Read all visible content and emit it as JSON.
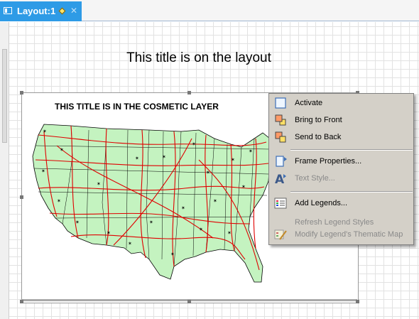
{
  "tab": {
    "label": "Layout:1"
  },
  "layout_title": "This title is on the layout",
  "cosmetic_title": "THIS TITLE IS IN THE COSMETIC LAYER",
  "map": {
    "land_color": "#c4f3c0",
    "road_color": "#e00000",
    "border_color": "#000000"
  },
  "context_menu": {
    "items": [
      {
        "label": "Activate",
        "icon": "activate-icon",
        "enabled": true
      },
      {
        "label": "Bring to Front",
        "icon": "bring-to-front-icon",
        "enabled": true
      },
      {
        "label": "Send to Back",
        "icon": "send-to-back-icon",
        "enabled": true
      },
      {
        "label": "Frame Properties...",
        "icon": "frame-properties-icon",
        "enabled": true
      },
      {
        "label": "Text Style...",
        "icon": "text-style-icon",
        "enabled": false
      },
      {
        "label": "Add Legends...",
        "icon": "add-legends-icon",
        "enabled": true
      },
      {
        "label": "Refresh Legend Styles",
        "icon": "",
        "enabled": false
      },
      {
        "label": "Modify Legend's Thematic Map",
        "icon": "modify-legend-icon",
        "enabled": false
      }
    ]
  }
}
